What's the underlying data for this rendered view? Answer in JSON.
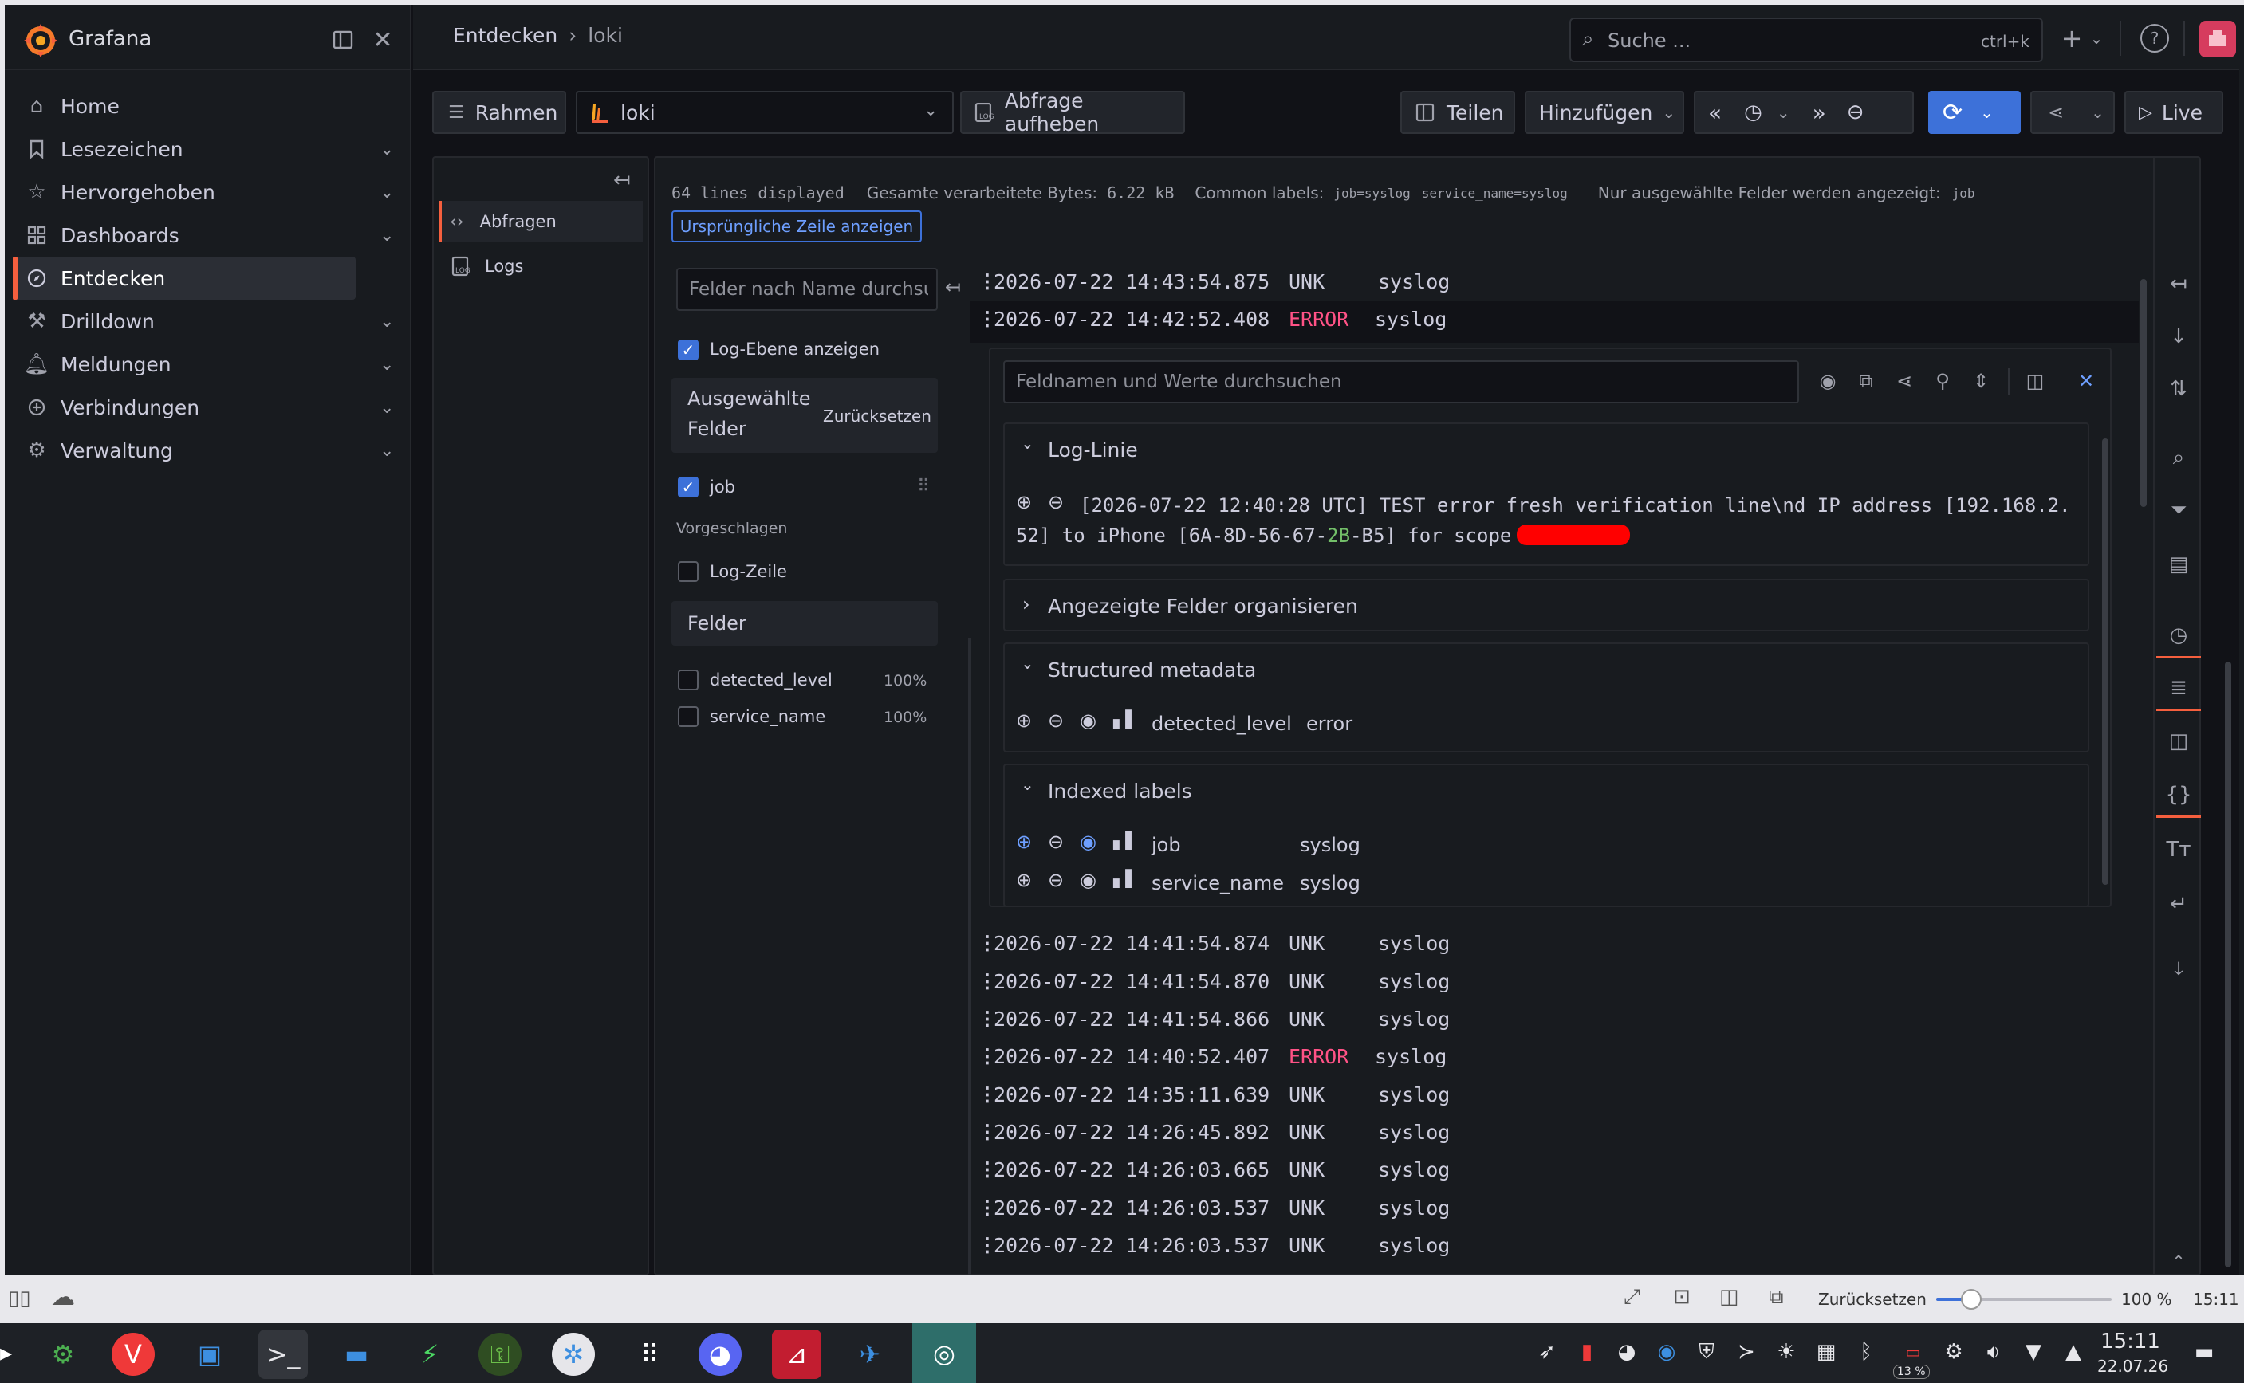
{
  "app": {
    "name": "Grafana"
  },
  "sidebar": {
    "items": [
      {
        "label": "Home",
        "icon": "home-icon"
      },
      {
        "label": "Lesezeichen",
        "icon": "bookmark-icon"
      },
      {
        "label": "Hervorgehoben",
        "icon": "star-icon"
      },
      {
        "label": "Dashboards",
        "icon": "grid-icon"
      },
      {
        "label": "Entdecken",
        "icon": "compass-icon"
      },
      {
        "label": "Drilldown",
        "icon": "drill-icon"
      },
      {
        "label": "Meldungen",
        "icon": "bell-icon"
      },
      {
        "label": "Verbindungen",
        "icon": "plug-icon"
      },
      {
        "label": "Verwaltung",
        "icon": "gear-icon"
      }
    ]
  },
  "header": {
    "breadcrumb": [
      "Entdecken",
      "loki"
    ],
    "search_placeholder": "Suche ...",
    "search_shortcut": "ctrl+k"
  },
  "toolbar": {
    "rahmen": "Rahmen",
    "datasource": "loki",
    "abfrage_aufheben": "Abfrage aufheben",
    "teilen": "Teilen",
    "hinzufuegen": "Hinzufügen",
    "live": "Live"
  },
  "query_pane": {
    "items": [
      "Abfragen",
      "Logs"
    ]
  },
  "logs": {
    "meta": {
      "lines_displayed": "64 lines displayed",
      "bytes_label": "Gesamte verarbeitete Bytes:",
      "bytes_value": "6.22 kB",
      "common_labels_label": "Common labels:",
      "common_label_1": "job=syslog",
      "common_label_2": "service_name=syslog",
      "selected_fields_label": "Nur ausgewählte Felder werden angezeigt:",
      "selected_field": "job"
    },
    "original_line_button": "Ursprüngliche Zeile anzeigen",
    "fields": {
      "search_placeholder": "Felder nach Name durchsu",
      "show_log_level": "Log-Ebene anzeigen",
      "selected_title_1": "Ausgewählte",
      "selected_title_2": "Felder",
      "reset": "Zurücksetzen",
      "selected_field": "job",
      "suggested": "Vorgeschlagen",
      "log_zeile": "Log-Zeile",
      "felder": "Felder",
      "field_list": [
        {
          "name": "detected_level",
          "pct": "100%"
        },
        {
          "name": "service_name",
          "pct": "100%"
        }
      ]
    },
    "lines_top": [
      {
        "ts": "2026-07-22 14:43:54.875",
        "level": "UNK",
        "src": "syslog"
      },
      {
        "ts": "2026-07-22 14:42:52.408",
        "level": "ERROR",
        "src": "syslog"
      }
    ],
    "details": {
      "search_placeholder": "Feldnamen und Werte durchsuchen",
      "log_linie_title": "Log-Linie",
      "log_text_1": "[2026-07-22 12:40:28 UTC] TEST error fresh verification line\\nd IP address [192.168.2.",
      "log_text_2a": "52] to iPhone [6A-8D-56-67-",
      "log_text_2b": "2B",
      "log_text_2c": "-B5] for scope",
      "organize_title": "Angezeigte Felder organisieren",
      "structured_title": "Structured metadata",
      "structured": [
        {
          "key": "detected_level",
          "value": "error"
        }
      ],
      "indexed_title": "Indexed labels",
      "indexed": [
        {
          "key": "job",
          "value": "syslog"
        },
        {
          "key": "service_name",
          "value": "syslog"
        }
      ]
    },
    "lines_bottom": [
      {
        "ts": "2026-07-22 14:41:54.874",
        "level": "UNK",
        "src": "syslog"
      },
      {
        "ts": "2026-07-22 14:41:54.870",
        "level": "UNK",
        "src": "syslog"
      },
      {
        "ts": "2026-07-22 14:41:54.866",
        "level": "UNK",
        "src": "syslog"
      },
      {
        "ts": "2026-07-22 14:40:52.407",
        "level": "ERROR",
        "src": "syslog"
      },
      {
        "ts": "2026-07-22 14:35:11.639",
        "level": "UNK",
        "src": "syslog"
      },
      {
        "ts": "2026-07-22 14:26:45.892",
        "level": "UNK",
        "src": "syslog"
      },
      {
        "ts": "2026-07-22 14:26:03.665",
        "level": "UNK",
        "src": "syslog"
      },
      {
        "ts": "2026-07-22 14:26:03.537",
        "level": "UNK",
        "src": "syslog"
      },
      {
        "ts": "2026-07-22 14:26:03.537",
        "level": "UNK",
        "src": "syslog"
      }
    ]
  },
  "statusbar": {
    "reset": "Zurücksetzen",
    "zoom": "100 %",
    "zoom_fraction": 0.2,
    "time": "15:11"
  },
  "taskbar": {
    "clock_time": "15:11",
    "clock_date": "22.07.26",
    "battery": "13 %"
  },
  "colors": {
    "accent": "#3d71d9",
    "error": "#ff5286",
    "brand": "#f55f3e",
    "redaction": "#ff0000"
  }
}
